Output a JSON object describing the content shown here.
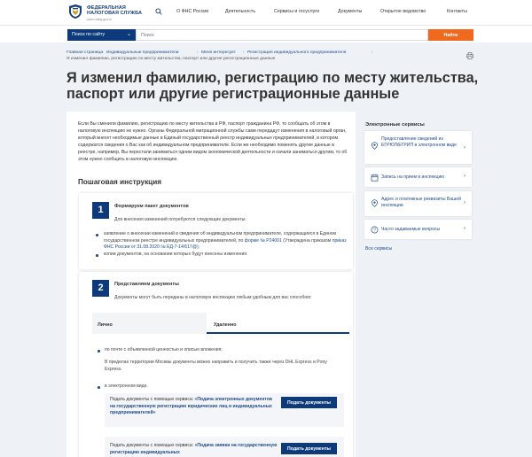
{
  "header": {
    "logo_line1": "ФЕДЕРАЛЬНАЯ",
    "logo_line2": "НАЛОГОВАЯ СЛУЖБА",
    "logo_url": "www.nalog.gov.ru",
    "nav": [
      "О ФНС России",
      "Деятельность",
      "Сервисы и госуслуги",
      "Документы",
      "Открытое ведомство",
      "Контакты"
    ]
  },
  "search": {
    "scope": "Поиск по сайту",
    "placeholder": "Поиск",
    "button": "Найти"
  },
  "breadcrumb": [
    "Главная страница",
    "Индивидуальные предприниматели",
    "Меня интересует",
    "Регистрация индивидуального предпринимателя",
    "Я изменил фамилию, регистрацию по месту жительства, паспорт или другие регистрационные данные"
  ],
  "title": "Я изменил фамилию, регистрацию по месту жительства, паспорт или другие регистрационные данные",
  "intro": "Если Вы сменили фамилию, регистрацию по месту жительства в РФ, паспорт гражданина РФ, то сообщать об этом в налоговую инспекцию не нужно. Органы Федеральной миграционной службы сами передадут изменения в налоговый орган, который внесет необходимые данные в Единый государственный реестр индивидуальных предпринимателей, в котором содержатся сведения о Вас как об индивидуальном предпринимателе. Если же необходимо поменять другие данные в реестре, например, Вы перестали заниматься одним видом экономической деятельности и начали заниматься другим, то об этом нужно сообщить в налоговую инспекцию.",
  "steps_heading": "Пошаговая инструкция",
  "step1": {
    "num": "1",
    "title": "Формируем пакет документов",
    "lead": "Для внесения изменений потребуются следующие документы:",
    "item1_a": "заявление о внесении изменений в сведения об индивидуальном предпринимателе, содержащиеся в Едином государственном реестре индивидуальных предпринимателей, по ",
    "item1_link1": "форме № Р24001",
    "item1_b": " (Утверждена приказом ",
    "item1_link2": "приказ ФНС России от 31.08.2020 № ЕД-7-14/617@",
    "item1_c": ");",
    "item2": "копии документов, на основании которых будут внесены изменения."
  },
  "step2": {
    "num": "2",
    "title": "Представляем документы",
    "lead": "Документы могут быть переданы в налоговую инспекцию любым удобным для вас способом:",
    "tab_personal": "Лично",
    "tab_remote": "Удаленно",
    "item1": "по почте с объявленной ценностью и описью вложения;",
    "item1_note": "В пределах территории Москвы документы можно направить и получить также через DHL Express и Pony Express.",
    "item2": "в электронном виде.",
    "svc1_prefix": "Подать документы с помощью сервиса: ",
    "svc1_bold": "«Подача электронных документов на государственную регистрацию юридических лиц и индивидуальных предпринимателей»",
    "svc_button": "Подать документы",
    "svc2_prefix": "Подать документы с помощью сервиса: ",
    "svc2_bold": "«Подача заявки на государственную регистрацию индивидуальных"
  },
  "sidebar": {
    "heading": "Электронные сервисы",
    "items": [
      "Предоставление сведений из ЕГРЮЛ/ЕГРИП в электронном виде",
      "Запись на прием в инспекцию",
      "Адрес и платежные реквизиты Вашей инспекции",
      "Часто задаваемые вопросы"
    ],
    "all": "Все сервисы"
  },
  "colors": {
    "brand": "#0c3a7b",
    "accent": "#ef6a1f",
    "link": "#1f4c8a"
  }
}
